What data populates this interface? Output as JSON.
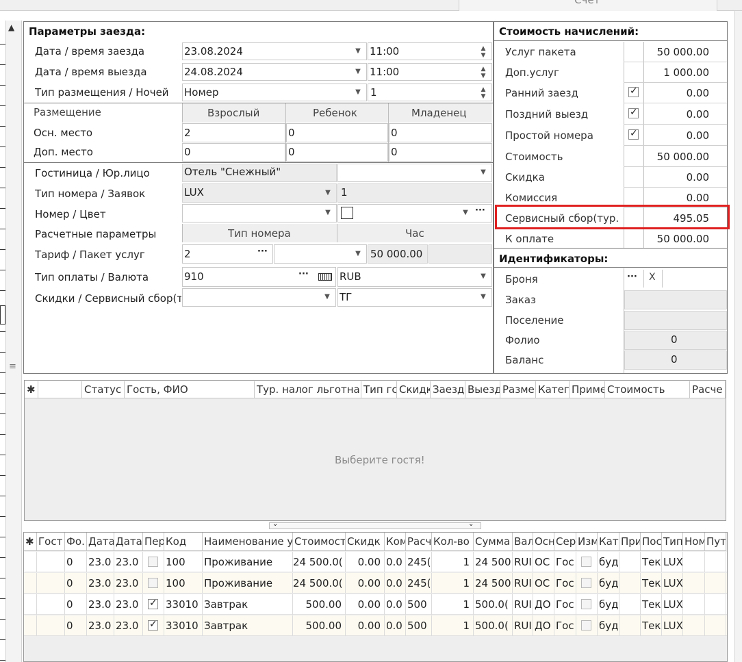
{
  "top_tab": "Счет",
  "params": {
    "title": "Параметры заезда:",
    "checkin": {
      "label": "Дата / время заезда",
      "date": "23.08.2024",
      "time": "11:00"
    },
    "checkout": {
      "label": "Дата / время выезда",
      "date": "24.08.2024",
      "time": "11:00"
    },
    "placement": {
      "label": "Тип размещения / Ночей",
      "type": "Номер",
      "nights": "1"
    },
    "occupancy": {
      "label": "Размещение",
      "adult": "Взрослый",
      "child": "Ребенок",
      "infant": "Младенец",
      "main": {
        "label": "Осн. место",
        "adult": "2",
        "child": "0",
        "infant": "0"
      },
      "extra": {
        "label": "Доп. место",
        "adult": "0",
        "child": "0",
        "infant": "0"
      }
    },
    "hotel": {
      "label": "Гостиница / Юр.лицо",
      "value": "Отель \"Снежный\"",
      "entity": ""
    },
    "roomtype": {
      "label": "Тип номера / Заявок",
      "value": "LUX",
      "count": "1"
    },
    "room": {
      "label": "Номер / Цвет",
      "value": "",
      "color": ""
    },
    "calc": {
      "label": "Расчетные параметры",
      "col1": "Тип номера",
      "col2": "Час"
    },
    "tariff": {
      "label": "Тариф / Пакет услуг",
      "value": "2",
      "package": "",
      "amount": "50 000.00"
    },
    "payment": {
      "label": "Тип оплаты / Валюта",
      "value": "910",
      "currency": "RUB"
    },
    "discount": {
      "label": "Скидки / Сервисный сбор(т",
      "value": "",
      "fee": "ТГ"
    }
  },
  "costs": {
    "title": "Стоимость начислений:",
    "rows": [
      {
        "label": "Услуг пакета",
        "check": "",
        "value": "50 000.00"
      },
      {
        "label": "Доп.услуг",
        "check": "",
        "value": "1 000.00"
      },
      {
        "label": "Ранний заезд",
        "check": "on",
        "value": "0.00"
      },
      {
        "label": "Поздний выезд",
        "check": "on",
        "value": "0.00"
      },
      {
        "label": "Простой номера",
        "check": "on",
        "value": "0.00"
      },
      {
        "label": "Стоимость",
        "check": "",
        "value": "50 000.00"
      },
      {
        "label": "Скидка",
        "check": "",
        "value": "0.00"
      },
      {
        "label": "Комиссия",
        "check": "",
        "value": "0.00"
      },
      {
        "label": "Сервисный сбор(тур.",
        "check": "",
        "value": "495.05"
      },
      {
        "label": "К оплате",
        "check": "",
        "value": "50 000.00"
      }
    ]
  },
  "ids": {
    "title": "Идентификаторы:",
    "rows": [
      {
        "label": "Броня",
        "value": ""
      },
      {
        "label": "Заказ",
        "value": ""
      },
      {
        "label": "Поселение",
        "value": ""
      },
      {
        "label": "Фолио",
        "value": "0"
      },
      {
        "label": "Баланс",
        "value": "0"
      }
    ],
    "clear_label": "X",
    "ellipsis": "···"
  },
  "guests": {
    "columns": [
      "*",
      "",
      "Статус",
      "Гость, ФИО",
      "Тур. налог льготна",
      "Тип гс",
      "Скидк",
      "Заезд",
      "Выезд",
      "Разме",
      "Катег",
      "Приме",
      "Стоимость",
      "Расче"
    ],
    "empty_text": "Выберите гостя!"
  },
  "services": {
    "columns": [
      "*",
      "Гост",
      "Фо.",
      "Дата",
      "Дата",
      "Пер",
      "Код",
      "Наименование у",
      "Стоимост",
      "Скидк",
      "Ком",
      "Расч",
      "Кол-во",
      "Сумма",
      "Вал",
      "Осн",
      "Сер",
      "Изм",
      "Кат",
      "При",
      "Пос",
      "Тип",
      "Ном",
      "Пут"
    ],
    "rows": [
      {
        "fo": "0",
        "d1": "23.0",
        "d2": "23.0",
        "per": "off",
        "code": "100",
        "name": "Проживание",
        "cost": "24 500.0(",
        "disc": "0.00",
        "kom": "0.0",
        "rasch": "245(",
        "qty": "1",
        "sum": "24 500",
        "val": "RUI",
        "osn": "ОС",
        "ser": "Гос",
        "izm": "off",
        "kat": "буд",
        "pri": "",
        "pos": "Тек",
        "tip": "LUX",
        "nom": "",
        "put": ""
      },
      {
        "fo": "0",
        "d1": "23.0",
        "d2": "23.0",
        "per": "off",
        "code": "100",
        "name": "Проживание",
        "cost": "24 500.0(",
        "disc": "0.00",
        "kom": "0.0",
        "rasch": "245(",
        "qty": "1",
        "sum": "24 500",
        "val": "RUI",
        "osn": "ОС",
        "ser": "Гос",
        "izm": "off",
        "kat": "буд",
        "pri": "",
        "pos": "Тек",
        "tip": "LUX",
        "nom": "",
        "put": ""
      },
      {
        "fo": "0",
        "d1": "23.0",
        "d2": "23.0",
        "per": "on",
        "code": "33010",
        "name": "Завтрак",
        "cost": "500.00",
        "disc": "0.00",
        "kom": "0.0",
        "rasch": "500",
        "qty": "1",
        "sum": "500.0(",
        "val": "RUI",
        "osn": "ДО",
        "ser": "Гос",
        "izm": "off",
        "kat": "буд",
        "pri": "",
        "pos": "Тек",
        "tip": "LUX",
        "nom": "",
        "put": ""
      },
      {
        "fo": "0",
        "d1": "23.0",
        "d2": "23.0",
        "per": "on",
        "code": "33010",
        "name": "Завтрак",
        "cost": "500.00",
        "disc": "0.00",
        "kom": "0.0",
        "rasch": "500",
        "qty": "1",
        "sum": "500.0(",
        "val": "RUI",
        "osn": "ДО",
        "ser": "Гос",
        "izm": "off",
        "kat": "буд",
        "pri": "",
        "pos": "Тек",
        "tip": "LUX",
        "nom": "",
        "put": ""
      }
    ]
  },
  "highlight_color": "#e02020"
}
